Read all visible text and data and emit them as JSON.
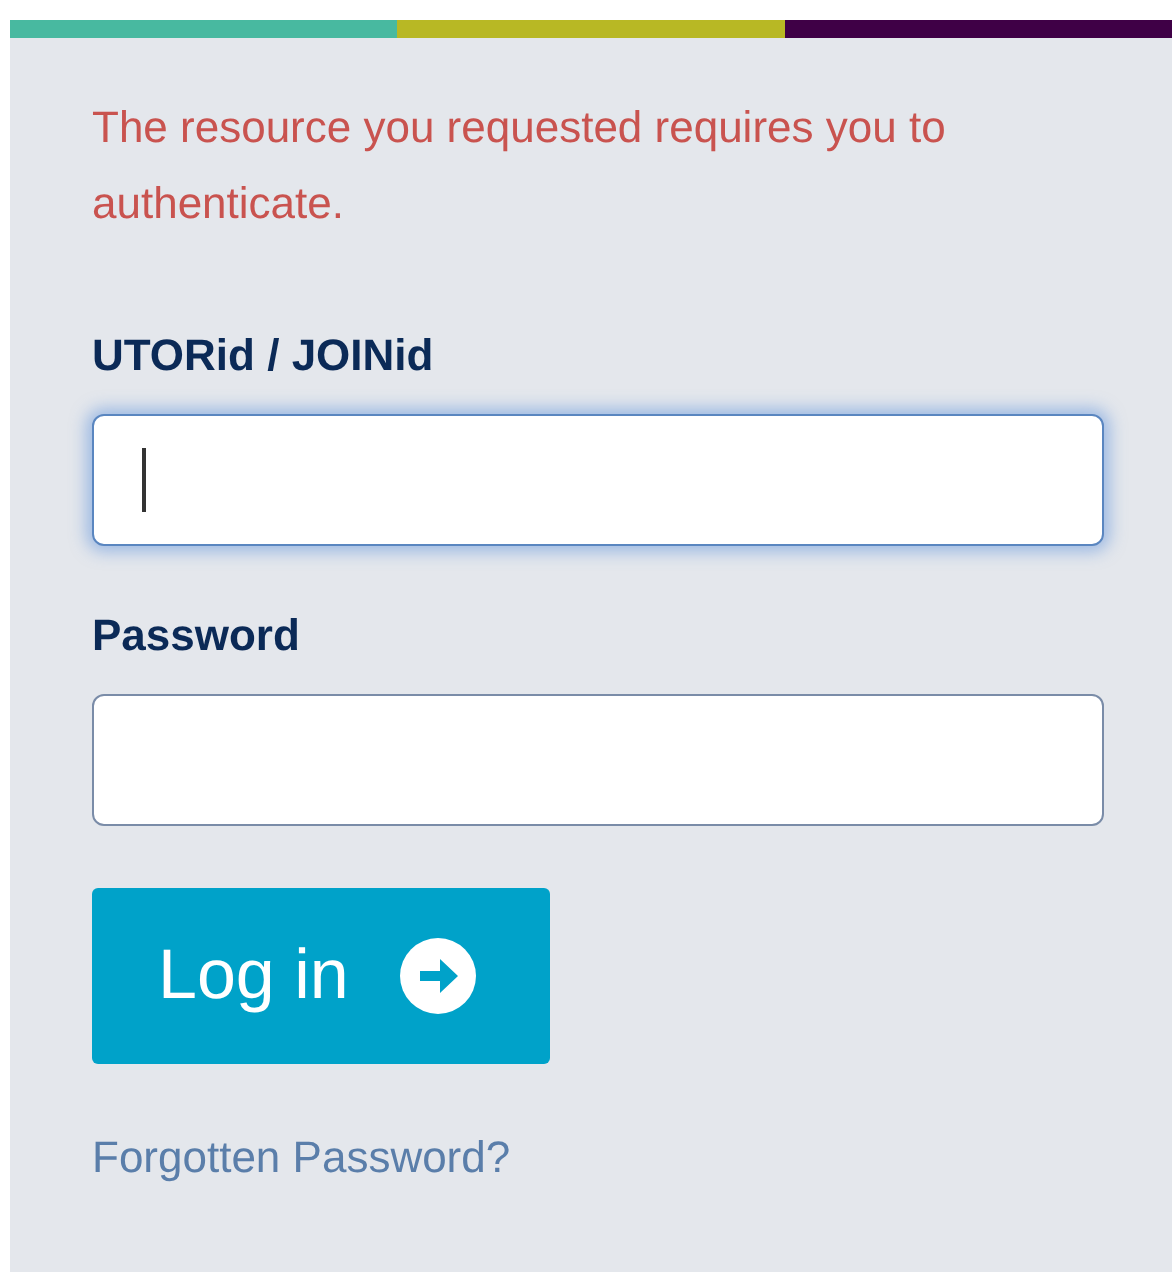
{
  "message": "The resource you requested requires you to authenticate.",
  "fields": [
    {
      "label": "UTORid / JOINid",
      "focused": true
    },
    {
      "label": "Password",
      "focused": false
    }
  ],
  "login_button": {
    "label": "Log in"
  },
  "forgot_link": "Forgotten Password?"
}
